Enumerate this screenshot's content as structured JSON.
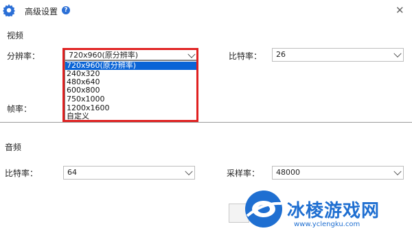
{
  "window": {
    "title": "高级设置",
    "help_icon": "question-circle-icon",
    "close_glyph": "✕"
  },
  "video": {
    "section_label": "视频",
    "resolution": {
      "label": "分辨率：",
      "value": "720x960(原分辨率)",
      "options": [
        "720x960(原分辨率)",
        "240x320",
        "480x640",
        "600x800",
        "750x1000",
        "1200x1600",
        "自定义"
      ]
    },
    "bitrate": {
      "label": "比特率：",
      "value": "26"
    },
    "framerate": {
      "label": "帧率："
    }
  },
  "audio": {
    "section_label": "音频",
    "bitrate": {
      "label": "比特率：",
      "value": "64"
    },
    "samplerate": {
      "label": "采样率：",
      "value": "48000"
    }
  },
  "watermark": {
    "text": "冰棱游戏网",
    "url": "www.yclengku.com"
  },
  "colors": {
    "accent": "#0a64d6",
    "highlight_frame": "#e02020",
    "brand": "#1f6fd1"
  }
}
